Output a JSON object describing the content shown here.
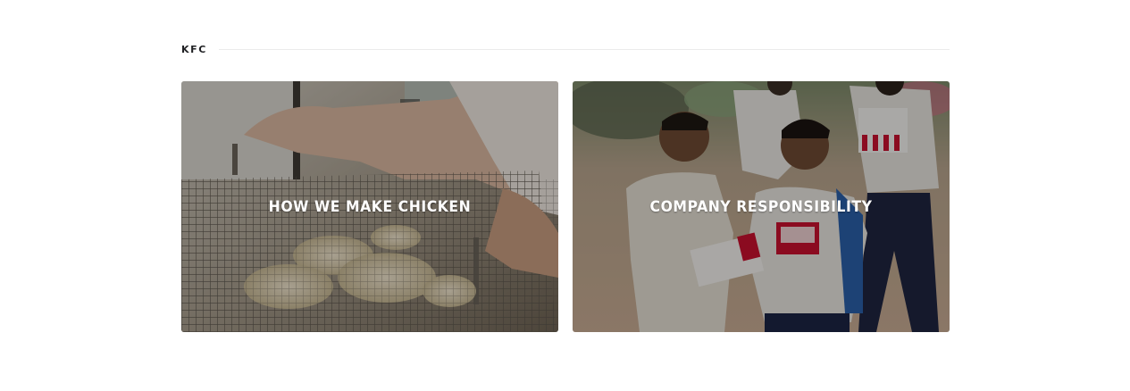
{
  "section": {
    "brand": "KFC"
  },
  "cards": [
    {
      "title": "HOW WE MAKE CHICKEN",
      "image": "chicken-breading-basket-photo"
    },
    {
      "title": "COMPANY RESPONSIBILITY",
      "image": "children-with-kfc-boxes-photo"
    }
  ],
  "colors": {
    "text_dark": "#202124",
    "rule": "#ebebeb",
    "overlay_text": "#ffffff",
    "kfc_red": "#c8102e"
  }
}
